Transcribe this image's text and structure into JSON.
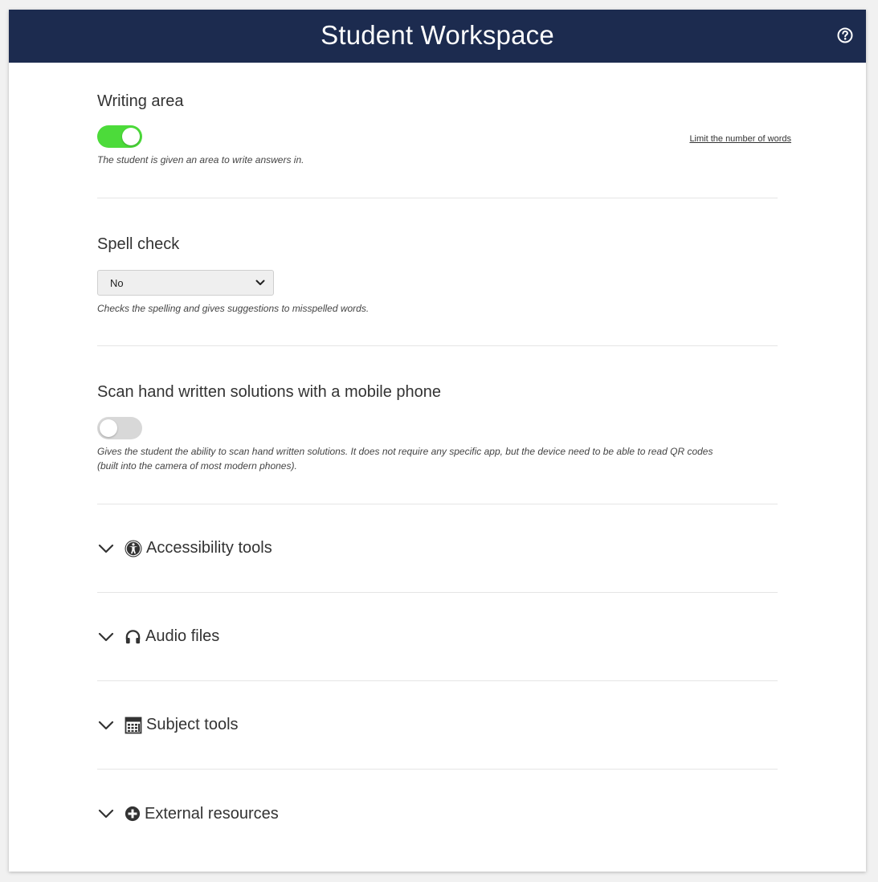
{
  "header": {
    "title": "Student Workspace"
  },
  "writing_area": {
    "title": "Writing area",
    "toggle_on": true,
    "description": "The student is given an area to write answers in.",
    "limit_link": "Limit the number of words"
  },
  "spell_check": {
    "title": "Spell check",
    "selected": "No",
    "description": "Checks the spelling and gives suggestions to misspelled words."
  },
  "scan": {
    "title": "Scan hand written solutions with a mobile phone",
    "toggle_on": false,
    "description_line1": "Gives the student the ability to scan hand written solutions. It does not require any specific app, but the device need to be able to read QR codes",
    "description_line2": "(built into the camera of most modern phones)."
  },
  "collapsibles": [
    {
      "label": "Accessibility tools",
      "icon": "accessibility-icon"
    },
    {
      "label": "Audio files",
      "icon": "headphones-icon"
    },
    {
      "label": "Subject tools",
      "icon": "calculator-icon"
    },
    {
      "label": "External resources",
      "icon": "plus-circle-icon"
    }
  ],
  "colors": {
    "header_bg": "#1c2b4f",
    "toggle_on": "#4cdb3a",
    "toggle_off": "#d8d8d8"
  }
}
